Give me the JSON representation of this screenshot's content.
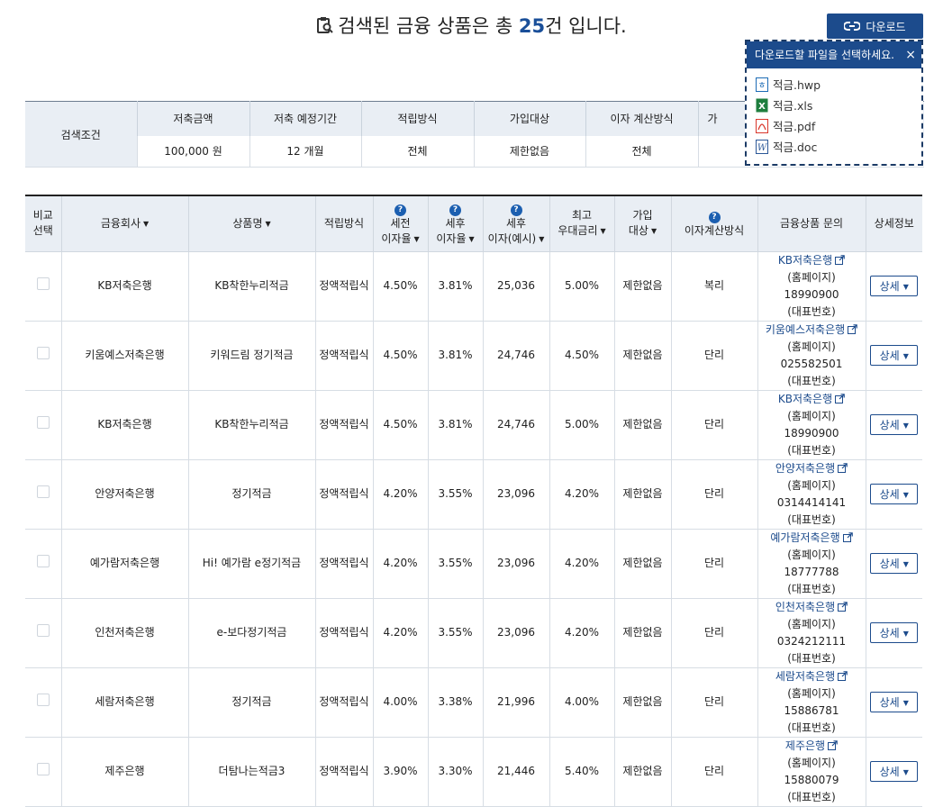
{
  "header": {
    "title_prefix": "검색된 금융 상품은 총 ",
    "count": "25",
    "title_suffix": "건 입니다."
  },
  "download": {
    "button_label": "다운로드",
    "popup_title": "다운로드할 파일을 선택하세요.",
    "close": "×",
    "files": [
      "적금.hwp",
      "적금.xls",
      "적금.pdf",
      "적금.doc"
    ]
  },
  "conditions": {
    "label": "검색조건",
    "headers": [
      "저축금액",
      "저축 예정기간",
      "적립방식",
      "가입대상",
      "이자 계산방식",
      "가"
    ],
    "values": [
      "100,000 원",
      "12 개월",
      "전체",
      "제한없음",
      "전체",
      ""
    ]
  },
  "table": {
    "headers": {
      "compare_1": "비교",
      "compare_2": "선택",
      "company": "금융회사",
      "product": "상품명",
      "method": "적립방식",
      "pretax_1": "세전",
      "pretax_2": "이자율",
      "posttax_1": "세후",
      "posttax_2": "이자율",
      "postamt_1": "세후",
      "postamt_2": "이자(예시)",
      "max_1": "최고",
      "max_2": "우대금리",
      "target_1": "가입",
      "target_2": "대상",
      "calc": "이자계산방식",
      "inquiry": "금융상품 문의",
      "detail": "상세정보"
    },
    "help_mark": "?",
    "homepage_label": "(홈페이지)",
    "phone_label": "(대표번호)",
    "detail_label": "상세",
    "rows": [
      {
        "company": "KB저축은행",
        "product": "KB착한누리적금",
        "method": "정액적립식",
        "pretax": "4.50%",
        "posttax": "3.81%",
        "amount": "25,036",
        "max": "5.00%",
        "target": "제한없음",
        "calc": "복리",
        "inquiry_name": "KB저축은행",
        "phone": "18990900"
      },
      {
        "company": "키움예스저축은행",
        "product": "키워드림 정기적금",
        "method": "정액적립식",
        "pretax": "4.50%",
        "posttax": "3.81%",
        "amount": "24,746",
        "max": "4.50%",
        "target": "제한없음",
        "calc": "단리",
        "inquiry_name": "키움예스저축은행",
        "phone": "025582501"
      },
      {
        "company": "KB저축은행",
        "product": "KB착한누리적금",
        "method": "정액적립식",
        "pretax": "4.50%",
        "posttax": "3.81%",
        "amount": "24,746",
        "max": "5.00%",
        "target": "제한없음",
        "calc": "단리",
        "inquiry_name": "KB저축은행",
        "phone": "18990900"
      },
      {
        "company": "안양저축은행",
        "product": "정기적금",
        "method": "정액적립식",
        "pretax": "4.20%",
        "posttax": "3.55%",
        "amount": "23,096",
        "max": "4.20%",
        "target": "제한없음",
        "calc": "단리",
        "inquiry_name": "안양저축은행",
        "phone": "0314414141"
      },
      {
        "company": "예가람저축은행",
        "product": "Hi! 예가람 e정기적금",
        "method": "정액적립식",
        "pretax": "4.20%",
        "posttax": "3.55%",
        "amount": "23,096",
        "max": "4.20%",
        "target": "제한없음",
        "calc": "단리",
        "inquiry_name": "예가람저축은행",
        "phone": "18777788"
      },
      {
        "company": "인천저축은행",
        "product": "e-보다정기적금",
        "method": "정액적립식",
        "pretax": "4.20%",
        "posttax": "3.55%",
        "amount": "23,096",
        "max": "4.20%",
        "target": "제한없음",
        "calc": "단리",
        "inquiry_name": "인천저축은행",
        "phone": "0324212111"
      },
      {
        "company": "세람저축은행",
        "product": "정기적금",
        "method": "정액적립식",
        "pretax": "4.00%",
        "posttax": "3.38%",
        "amount": "21,996",
        "max": "4.00%",
        "target": "제한없음",
        "calc": "단리",
        "inquiry_name": "세람저축은행",
        "phone": "15886781"
      },
      {
        "company": "제주은행",
        "product": "더탐나는적금3",
        "method": "정액적립식",
        "pretax": "3.90%",
        "posttax": "3.30%",
        "amount": "21,446",
        "max": "5.40%",
        "target": "제한없음",
        "calc": "단리",
        "inquiry_name": "제주은행",
        "phone": "15880079"
      }
    ]
  },
  "colors": {
    "accent": "#1c4b8c",
    "header_bg": "#e9eef4"
  }
}
